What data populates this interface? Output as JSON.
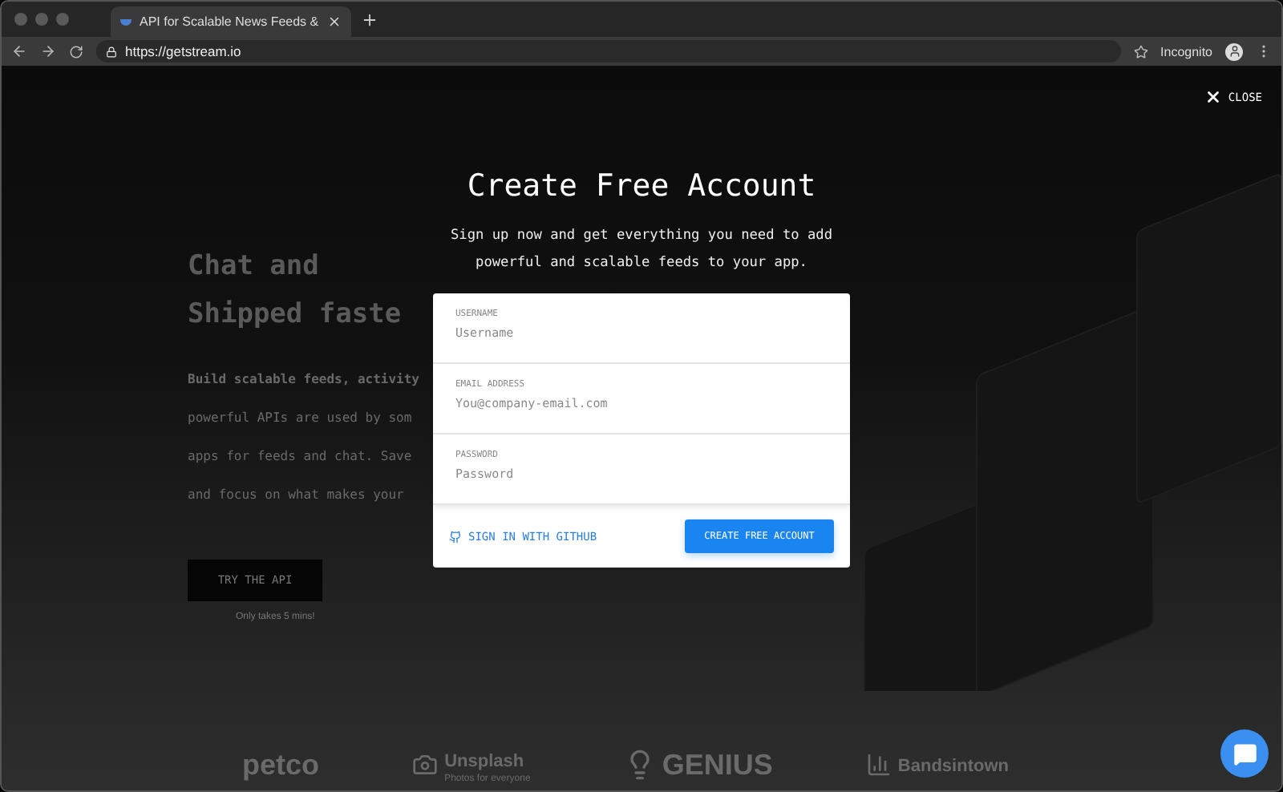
{
  "browser": {
    "tab_title": "API for Scalable News Feeds &",
    "url": "https://getstream.io",
    "profile_label": "Incognito"
  },
  "background_page": {
    "hero_lines": [
      "Chat and",
      "Shipped faste"
    ],
    "body_lines": [
      {
        "text": "**Build scalable feeds, activity**"
      },
      {
        "text": "powerful APIs are used by som"
      },
      {
        "text": "apps for feeds and chat. Save"
      },
      {
        "text": "and focus on what makes your"
      }
    ],
    "cta_button": "TRY THE API",
    "cta_note": "Only takes 5 mins!",
    "logos": [
      {
        "kind": "petco",
        "name": "petco"
      },
      {
        "kind": "camera",
        "name": "Unsplash",
        "caption": "Photos for everyone"
      },
      {
        "kind": "bulb",
        "name": "GENIUS"
      },
      {
        "kind": "bars",
        "name": "Bandsintown"
      }
    ]
  },
  "modal": {
    "close_label": "CLOSE",
    "title": "Create Free Account",
    "subtitle": "Sign up now and get everything you need to add powerful and scalable feeds to your app.",
    "fields": [
      {
        "label": "USERNAME",
        "placeholder": "Username"
      },
      {
        "label": "EMAIL ADDRESS",
        "placeholder": "You@company-email.com"
      },
      {
        "label": "PASSWORD",
        "placeholder": "Password"
      }
    ],
    "github_label": "SIGN IN WITH GITHUB",
    "submit_label": "CREATE FREE ACCOUNT"
  }
}
